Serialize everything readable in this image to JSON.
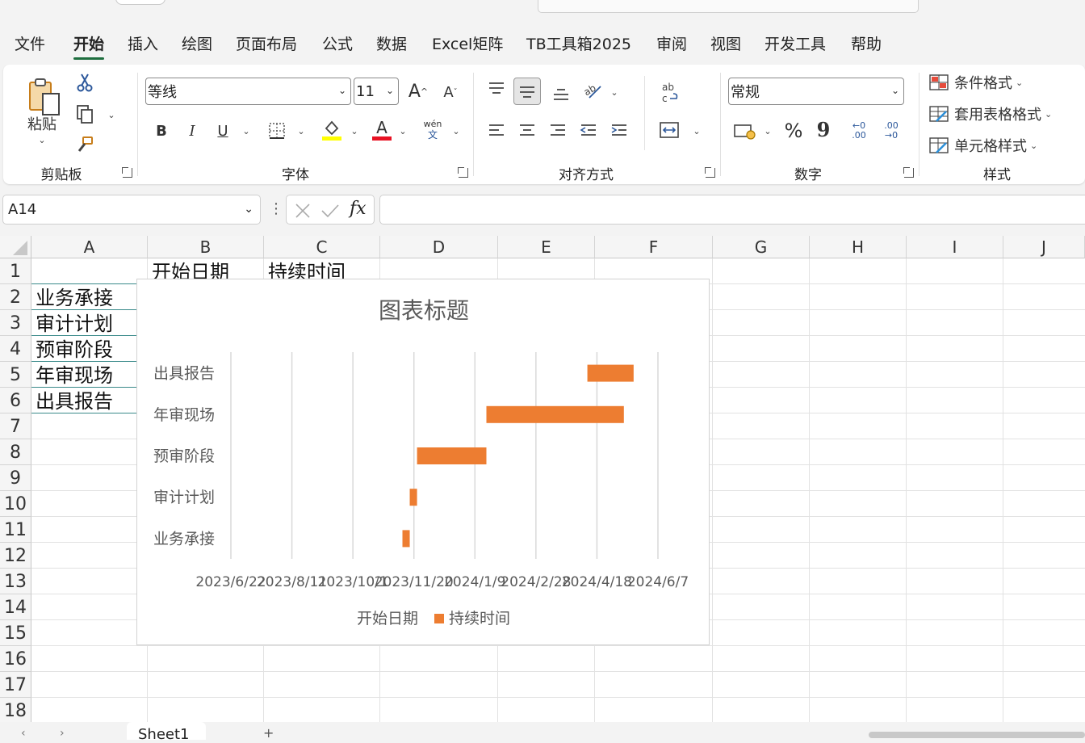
{
  "menu": {
    "tabs": [
      "文件",
      "开始",
      "插入",
      "绘图",
      "页面布局",
      "公式",
      "数据",
      "Excel矩阵",
      "TB工具箱2025",
      "审阅",
      "视图",
      "开发工具",
      "帮助"
    ],
    "active": "开始"
  },
  "ribbon": {
    "clipboard": {
      "label": "剪贴板",
      "paste_label": "粘贴"
    },
    "font": {
      "label": "字体",
      "font_name": "等线",
      "font_size": "11",
      "bold": "B",
      "italic": "I",
      "underline": "U",
      "phonetic": "wén",
      "phonetic_sub": "文",
      "font_color_glyph": "A",
      "grow_glyph": "A",
      "shrink_glyph": "A"
    },
    "alignment": {
      "label": "对齐方式"
    },
    "number": {
      "label": "数字",
      "format": "常规",
      "percent": "%",
      "comma": "9",
      "inc_decimal": "←0 .00",
      "dec_decimal": ".00 →0"
    },
    "styles": {
      "label": "样式",
      "conditional": "条件格式",
      "table_format": "套用表格格式",
      "cell_styles": "单元格样式"
    },
    "colors": {
      "highlight": "#ffff00",
      "font_color": "#e81123"
    }
  },
  "formula_bar": {
    "name_box": "A14",
    "formula": ""
  },
  "sheet": {
    "columns": [
      "A",
      "B",
      "C",
      "D",
      "E",
      "F",
      "G",
      "H",
      "I",
      "J"
    ],
    "rows": [
      "1",
      "2",
      "3",
      "4",
      "5",
      "6",
      "7",
      "8",
      "9",
      "10",
      "11",
      "12",
      "13",
      "14",
      "15",
      "16",
      "17",
      "18"
    ],
    "cells": {
      "B1": "开始日期",
      "C1": "持续时间",
      "A2": "业务承接",
      "A3": "审计计划",
      "A4": "预审阶段",
      "A5": "年审现场",
      "A6": "出具报告"
    },
    "tab": "Sheet1"
  },
  "chart_data": {
    "type": "bar",
    "orientation": "horizontal-stacked",
    "title": "图表标题",
    "categories": [
      "业务承接",
      "审计计划",
      "预审阶段",
      "年审现场",
      "出具报告"
    ],
    "series": [
      {
        "name": "开始日期",
        "values": [
          "2023-11-10",
          "2023-11-16",
          "2023-11-22",
          "2024-01-18",
          "2024-04-10"
        ],
        "fill": "none"
      },
      {
        "name": "持续时间",
        "values": [
          6,
          6,
          57,
          113,
          38
        ],
        "unit": "days",
        "color": "#ed7d31"
      }
    ],
    "x_ticks": [
      "2023/6/22",
      "2023/8/11",
      "2023/10/1",
      "2023/11/20",
      "2024/1/9",
      "2024/2/28",
      "2024/4/18",
      "2024/6/7"
    ],
    "xlim": [
      "2023-06-22",
      "2024-06-07"
    ],
    "gridlines": "vertical",
    "legend_position": "bottom"
  }
}
